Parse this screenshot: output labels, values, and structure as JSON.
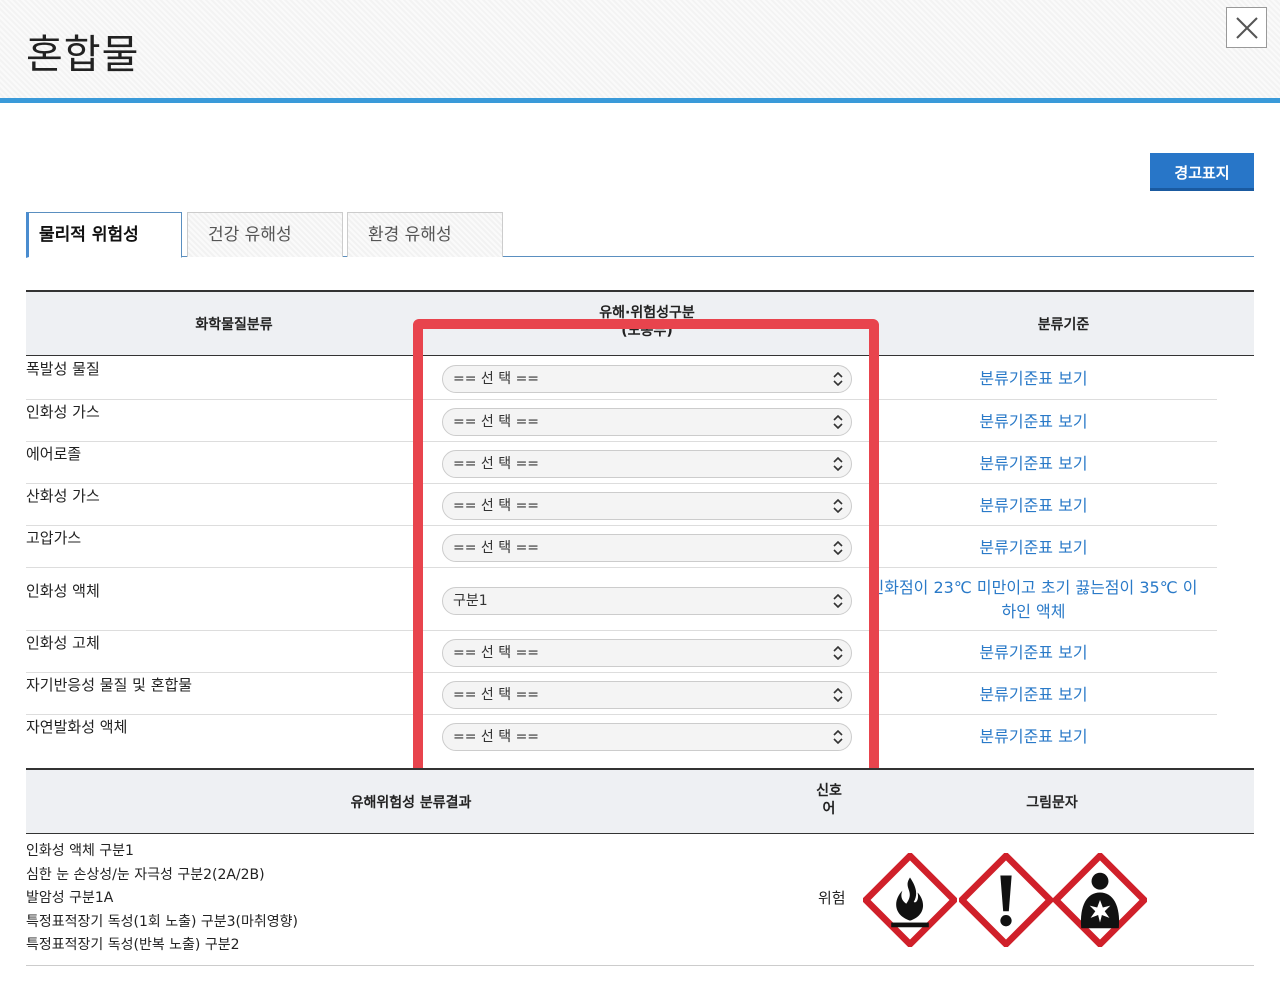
{
  "header": {
    "title": "혼합물",
    "close_label": "×"
  },
  "toolbar": {
    "warning_button": "경고표지"
  },
  "tabs": [
    {
      "label": "물리적 위험성",
      "active": true
    },
    {
      "label": "건강 유해성",
      "active": false
    },
    {
      "label": "환경 유해성",
      "active": false
    }
  ],
  "table": {
    "headers": {
      "classification": "화학물질분류",
      "hazard_line1": "유해·위험성구분",
      "hazard_line2": "(노동부)",
      "criteria": "분류기준"
    },
    "rows": [
      {
        "label": "폭발성 물질",
        "select": "== 선 택 ==",
        "link": "분류기준표 보기"
      },
      {
        "label": "인화성 가스",
        "select": "== 선 택 ==",
        "link": "분류기준표 보기"
      },
      {
        "label": "에어로졸",
        "select": "== 선 택 ==",
        "link": "분류기준표 보기"
      },
      {
        "label": "산화성 가스",
        "select": "== 선 택 ==",
        "link": "분류기준표 보기"
      },
      {
        "label": "고압가스",
        "select": "== 선 택 ==",
        "link": "분류기준표 보기"
      },
      {
        "label": "인화성 액체",
        "select": "구분1",
        "link": "인화점이 23℃ 미만이고 초기 끓는점이 35℃ 이하인 액체"
      },
      {
        "label": "인화성 고체",
        "select": "== 선 택 ==",
        "link": "분류기준표 보기"
      },
      {
        "label": "자기반응성 물질 및 혼합물",
        "select": "== 선 택 ==",
        "link": "분류기준표 보기"
      },
      {
        "label": "자연발화성 액체",
        "select": "== 선 택 ==",
        "link": "분류기준표 보기"
      }
    ]
  },
  "result_table": {
    "headers": {
      "result": "유해위험성 분류결과",
      "signal_line1": "신호",
      "signal_line2": "어",
      "pictogram": "그림문자"
    },
    "results": [
      "인화성 액체 구분1",
      "심한 눈 손상성/눈 자극성 구분2(2A/2B)",
      "발암성 구분1A",
      "특정표적장기 독성(1회 노출) 구분3(마취영향)",
      "특정표적장기 독성(반복 노출) 구분2"
    ],
    "signal_word": "위험",
    "pictograms": [
      "flame-pictogram",
      "exclamation-pictogram",
      "health-hazard-pictogram"
    ]
  },
  "colors": {
    "accent": "#3a9ad9",
    "button": "#2876c8",
    "link": "#2a7ac8",
    "highlight": "#e8444d",
    "pictogram_border": "#d0202a"
  }
}
